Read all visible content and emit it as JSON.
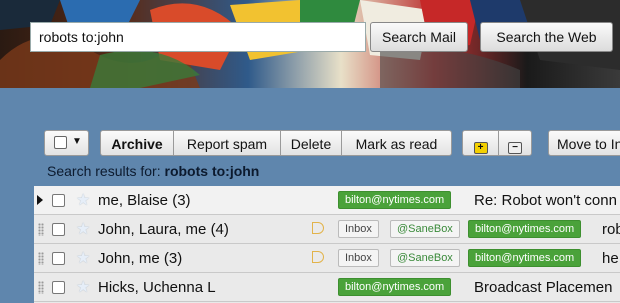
{
  "header": {
    "search_value": "robots to:john",
    "search_mail_label": "Search Mail",
    "search_web_label": "Search the Web"
  },
  "toolbar": {
    "archive": "Archive",
    "report_spam": "Report spam",
    "delete": "Delete",
    "mark_as_read": "Mark as read",
    "move_to": "Move to In"
  },
  "results": {
    "prefix": "Search results for: ",
    "query": "robots to:john"
  },
  "messages": [
    {
      "sender": "me, Blaise (3)",
      "tags": [
        "bilton@nytimes.com"
      ],
      "subject": "Re: Robot won't conn"
    },
    {
      "sender": "John, Laura, me (4)",
      "tags": [
        "Inbox",
        "@SaneBox",
        "bilton@nytimes.com"
      ],
      "subject": "rob"
    },
    {
      "sender": "John, me (3)",
      "tags": [
        "Inbox",
        "@SaneBox",
        "bilton@nytimes.com"
      ],
      "subject": "he"
    },
    {
      "sender": "Hicks, Uchenna L",
      "tags": [
        "bilton@nytimes.com"
      ],
      "subject": "Broadcast Placemen"
    }
  ],
  "colors": {
    "background": "#5f86ad",
    "label_green": "#4aa23a",
    "label_yellow": "#f4d000"
  },
  "icons": [
    "checkbox-icon",
    "dropdown-arrow-icon",
    "label-plus-icon",
    "label-minus-icon",
    "star-icon",
    "importance-marker-icon",
    "row-pointer-icon"
  ]
}
